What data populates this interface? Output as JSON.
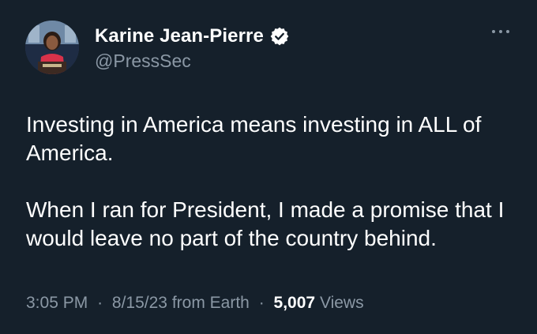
{
  "author": {
    "display_name": "Karine Jean-Pierre",
    "handle": "@PressSec",
    "verified_icon": "verified-badge-icon"
  },
  "tweet": {
    "paragraphs": [
      "Investing in America means investing in ALL of America.",
      "When I ran for President, I made a promise that I would leave no part of the country behind."
    ]
  },
  "meta": {
    "time": "3:05 PM",
    "date": "8/15/23",
    "source": "from Earth",
    "separator": "·",
    "view_count": "5,007",
    "views_label": "Views"
  },
  "colors": {
    "background": "#15202b",
    "text": "#ffffff",
    "muted": "#8b98a5",
    "verified": "#ffffff"
  },
  "icons": {
    "more": "more-horizontal-icon",
    "avatar": "profile-photo"
  }
}
